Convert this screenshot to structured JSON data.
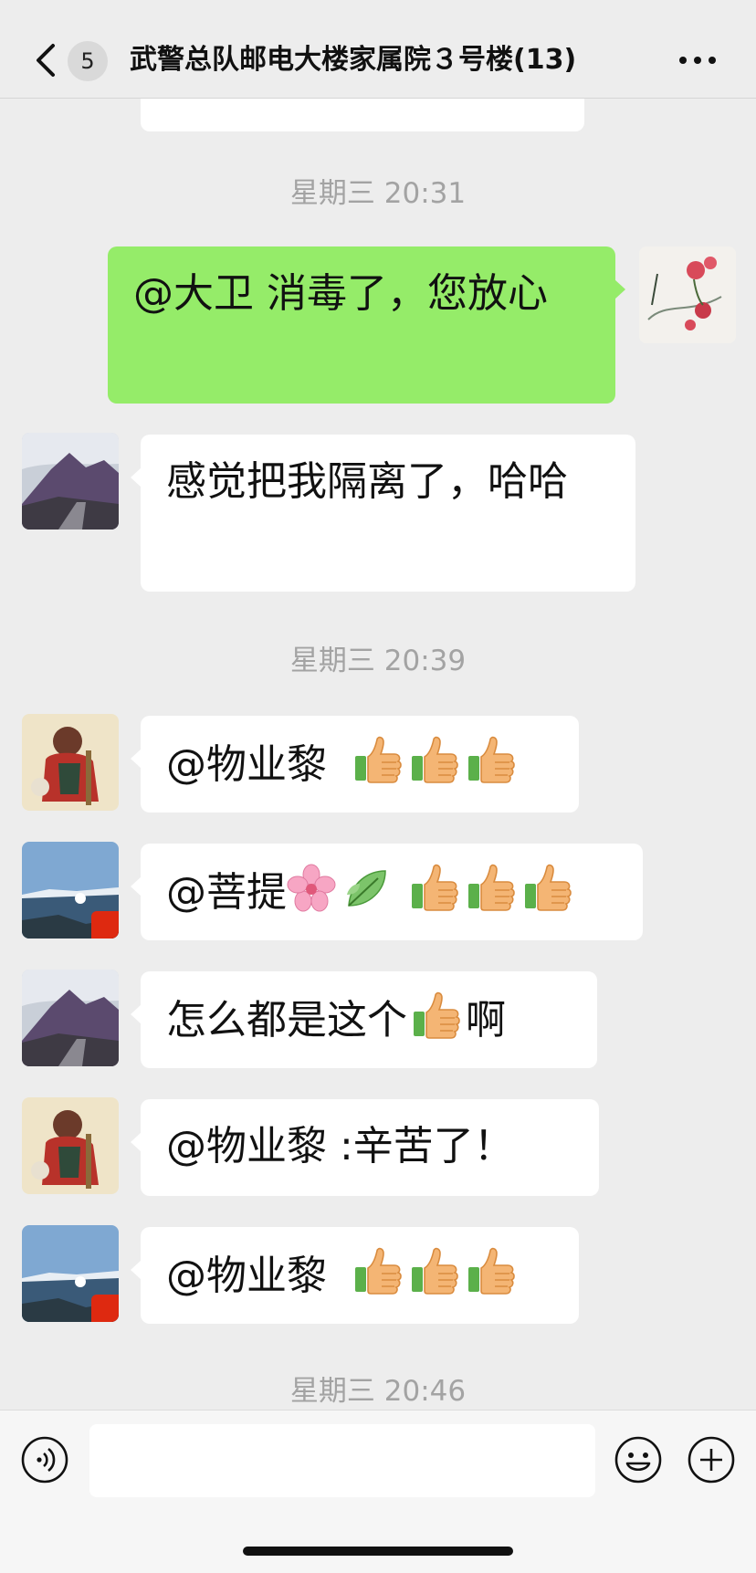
{
  "header": {
    "unread_count": "5",
    "title": "武警总队邮电大楼家属院３号楼(13)"
  },
  "messages": {
    "ts1": "星期三 20:31",
    "m1_text": "@大卫 消毒了，您放心",
    "m2_text": "感觉把我隔离了，哈哈",
    "ts2": "星期三 20:39",
    "m3_text": "@物业黎 ",
    "m4_text": "@菩提",
    "m5_text_a": "怎么都是这个",
    "m5_text_b": "啊",
    "m6_text": "@物业黎 :辛苦了！",
    "m7_text": "@物业黎 ",
    "ts3": "星期三 20:46"
  },
  "icons": {
    "back": "chevron-left-icon",
    "more": "more-dots-icon",
    "voice": "voice-icon",
    "emoji": "emoji-icon",
    "plus": "plus-icon",
    "reaction": "thumbs-up-icon"
  },
  "colors": {
    "background": "#ededed",
    "outgoing_bubble": "#95ec69",
    "incoming_bubble": "#ffffff",
    "timestamp": "#a3a3a3"
  }
}
